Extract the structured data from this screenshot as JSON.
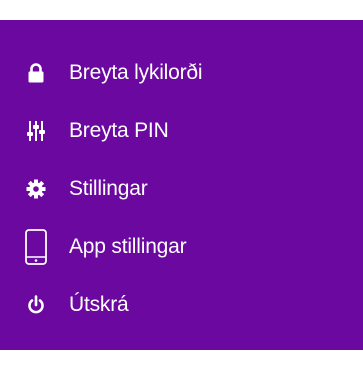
{
  "menu": {
    "items": [
      {
        "label": "Breyta lykilorði",
        "icon": "lock-icon"
      },
      {
        "label": "Breyta PIN",
        "icon": "sliders-icon"
      },
      {
        "label": "Stillingar",
        "icon": "gear-icon"
      },
      {
        "label": "App stillingar",
        "icon": "mobile-phone-icon"
      },
      {
        "label": "Útskrá",
        "icon": "power-icon"
      }
    ]
  },
  "colors": {
    "background": "#6b08a0",
    "text": "#ffffff"
  }
}
